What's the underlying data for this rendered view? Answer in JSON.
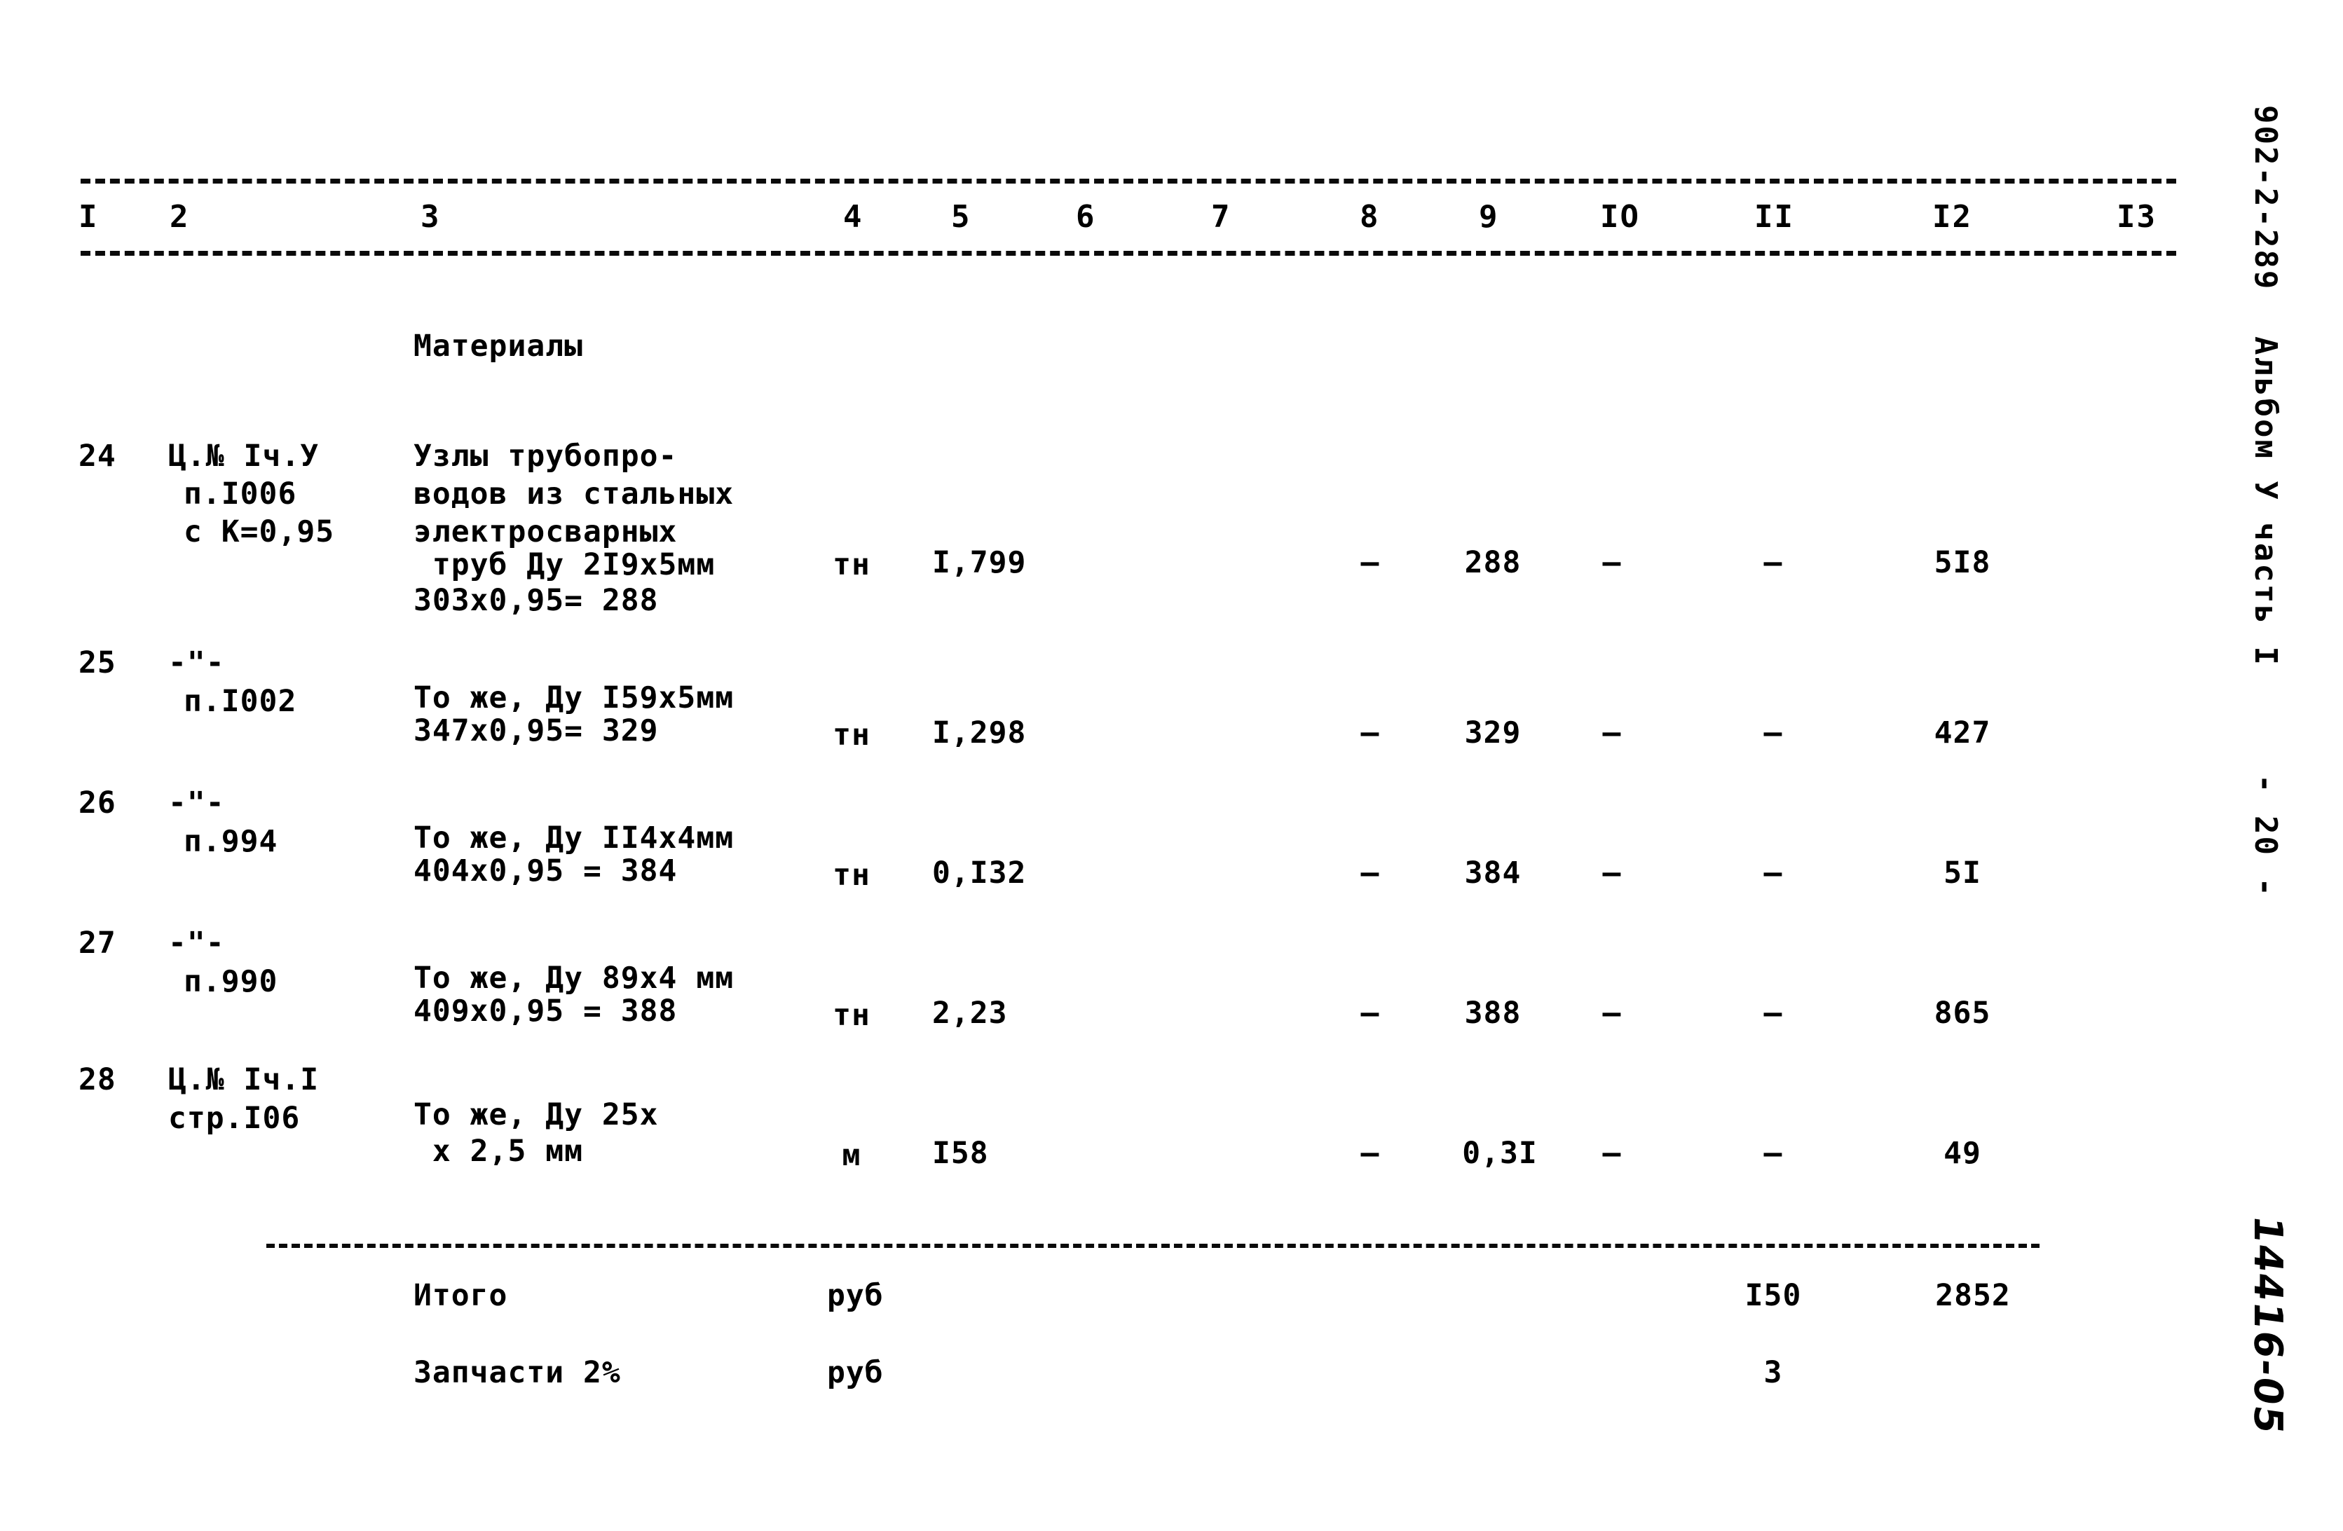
{
  "document": {
    "code": "902-2-289",
    "album": "Альбом У часть I",
    "page_number": "- 20 -",
    "archive_stamp": "14416-05"
  },
  "table": {
    "column_headers": [
      "I",
      "2",
      "3",
      "4",
      "5",
      "6",
      "7",
      "8",
      "9",
      "IO",
      "II",
      "I2",
      "I3"
    ],
    "section_title": "Материалы",
    "rows": [
      {
        "num": "24",
        "ref_lines": [
          "Ц.№ Iч.У",
          "п.I006",
          "с К=0,95"
        ],
        "desc_lines": [
          "Узлы трубопро-",
          "водов из стальных",
          "электросварных",
          " труб Ду 2I9x5мм",
          "303х0,95= 288"
        ],
        "unit": "тн",
        "qty": "I,799",
        "c6": "",
        "c7": "",
        "c8": "–",
        "c9": "288",
        "c10": "–",
        "c11": "–",
        "c12": "5I8",
        "c13": ""
      },
      {
        "num": "25",
        "ref_lines": [
          "-\"-",
          "п.I002"
        ],
        "desc_lines": [
          "То же, Ду I59x5мм",
          "347х0,95= 329"
        ],
        "unit": "тн",
        "qty": "I,298",
        "c6": "",
        "c7": "",
        "c8": "–",
        "c9": "329",
        "c10": "–",
        "c11": "–",
        "c12": "427",
        "c13": ""
      },
      {
        "num": "26",
        "ref_lines": [
          "-\"-",
          "п.994"
        ],
        "desc_lines": [
          "То же, Ду II4x4мм",
          "404х0,95 = 384"
        ],
        "unit": "тн",
        "qty": "0,I32",
        "c6": "",
        "c7": "",
        "c8": "–",
        "c9": "384",
        "c10": "–",
        "c11": "–",
        "c12": "5I",
        "c13": ""
      },
      {
        "num": "27",
        "ref_lines": [
          "-\"-",
          "п.990"
        ],
        "desc_lines": [
          "То же, Ду 89x4 мм",
          "409х0,95 = 388"
        ],
        "unit": "тн",
        "qty": "2,23",
        "c6": "",
        "c7": "",
        "c8": "–",
        "c9": "388",
        "c10": "–",
        "c11": "–",
        "c12": "865",
        "c13": ""
      },
      {
        "num": "28",
        "ref_lines": [
          "Ц.№ Iч.I",
          "стр.I06"
        ],
        "desc_lines": [
          "То же, Ду 25х",
          " х 2,5 мм"
        ],
        "unit": "м",
        "qty": "I58",
        "c6": "",
        "c7": "",
        "c8": "–",
        "c9": "0,3I",
        "c10": "–",
        "c11": "–",
        "c12": "49",
        "c13": ""
      }
    ],
    "summary": [
      {
        "label": "Итого",
        "unit": "руб",
        "c11": "I50",
        "c12": "2852"
      },
      {
        "label": "Запчасти 2%",
        "unit": "руб",
        "c11": "3",
        "c12": ""
      }
    ]
  }
}
